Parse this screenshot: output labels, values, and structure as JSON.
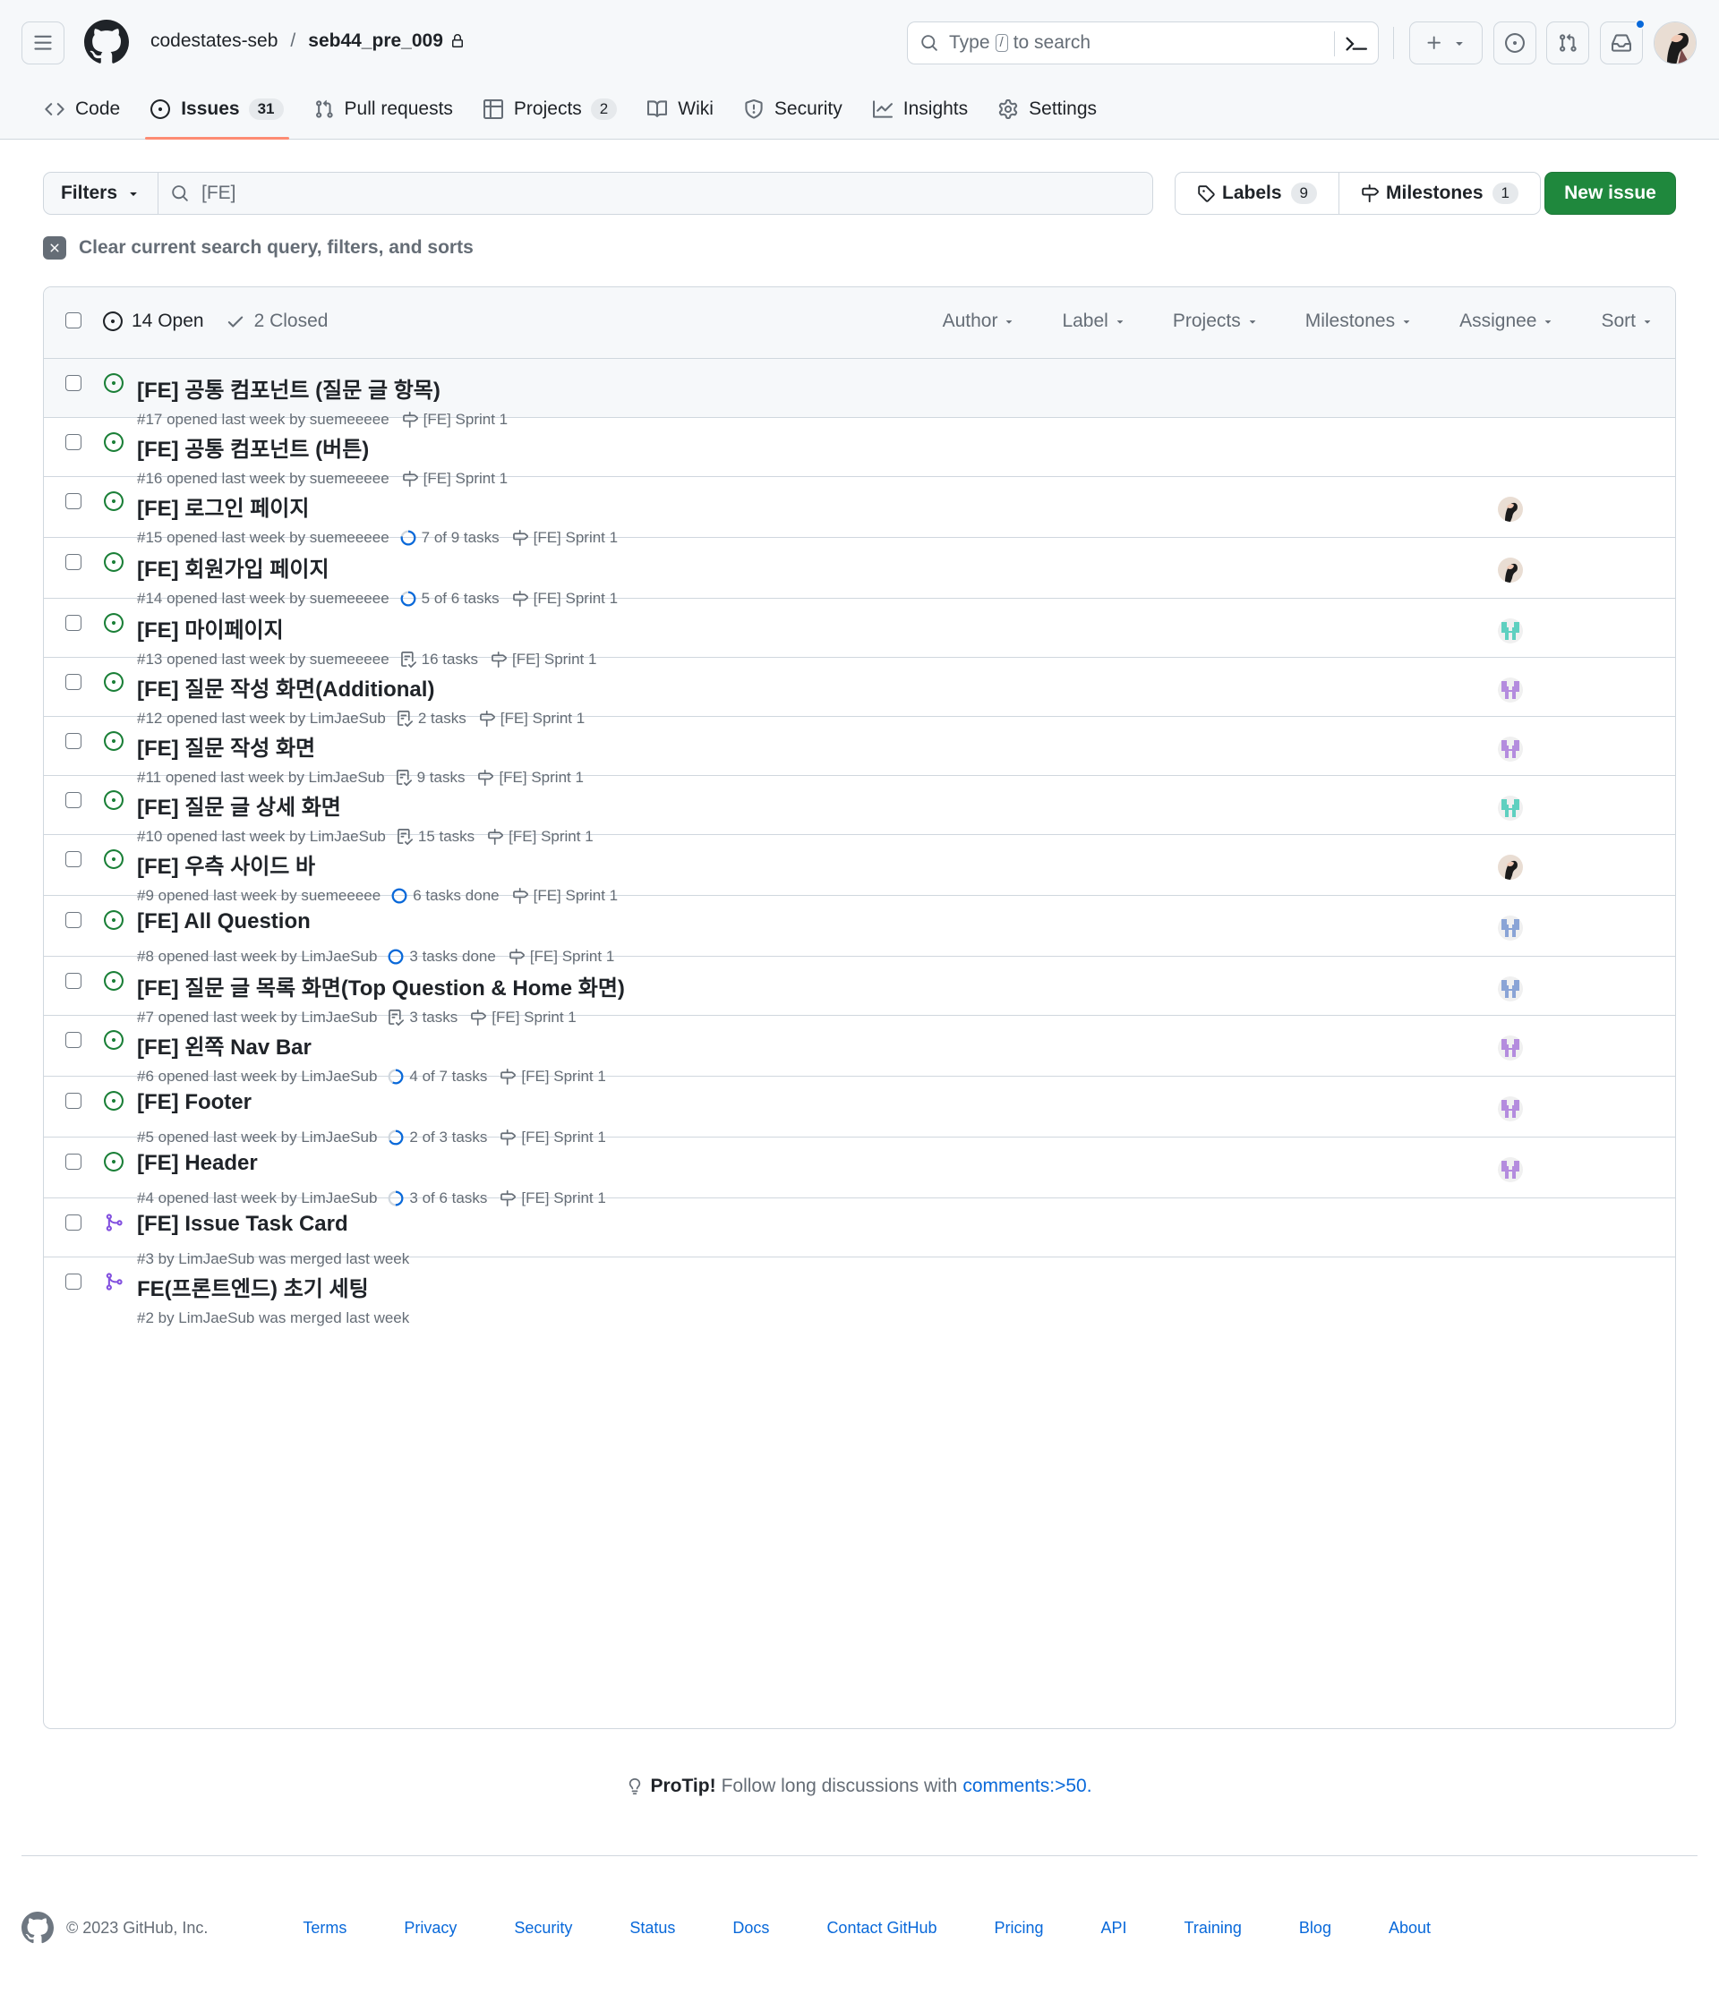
{
  "header": {
    "owner": "codestates-seb",
    "separator": "/",
    "repo": "seb44_pre_009",
    "search_prefix": "Type",
    "search_key": "/",
    "search_suffix": "to search"
  },
  "tabs": [
    {
      "label": "Code",
      "icon": "code-icon"
    },
    {
      "label": "Issues",
      "count": "31",
      "icon": "issue-opened-icon"
    },
    {
      "label": "Pull requests",
      "icon": "git-pull-request-icon"
    },
    {
      "label": "Projects",
      "count": "2",
      "icon": "table-icon"
    },
    {
      "label": "Wiki",
      "icon": "book-icon"
    },
    {
      "label": "Security",
      "icon": "shield-icon"
    },
    {
      "label": "Insights",
      "icon": "graph-icon"
    },
    {
      "label": "Settings",
      "icon": "gear-icon"
    }
  ],
  "filterbar": {
    "filters_label": "Filters",
    "query": "[FE]",
    "labels_label": "Labels",
    "labels_count": "9",
    "milestones_label": "Milestones",
    "milestones_count": "1",
    "new_issue_label": "New issue",
    "clear_label": "Clear current search query, filters, and sorts"
  },
  "list_header": {
    "open_label": "14 Open",
    "closed_label": "2 Closed",
    "filters": [
      "Author",
      "Label",
      "Projects",
      "Milestones",
      "Assignee",
      "Sort"
    ]
  },
  "issues": [
    {
      "title": "[FE] 공통 컴포넌트 (질문 글 항목)",
      "meta": "#17 opened last week by suemeeeee",
      "task": "",
      "task_icon": "",
      "milestone": "[FE] Sprint 1",
      "state": "open",
      "assignee": "",
      "highlighted": true
    },
    {
      "title": "[FE] 공통 컴포넌트 (버튼)",
      "meta": "#16 opened last week by suemeeeee",
      "task": "",
      "task_icon": "",
      "milestone": "[FE] Sprint 1",
      "state": "open",
      "assignee": ""
    },
    {
      "title": "[FE] 로그인 페이지",
      "meta": "#15 opened last week by suemeeeee",
      "task": "7 of 9 tasks",
      "task_icon": "progress",
      "task_progress": 0.78,
      "milestone": "[FE] Sprint 1",
      "state": "open",
      "assignee": "photo"
    },
    {
      "title": "[FE] 회원가입 페이지",
      "meta": "#14 opened last week by suemeeeee",
      "task": "5 of 6 tasks",
      "task_icon": "progress",
      "task_progress": 0.83,
      "milestone": "[FE] Sprint 1",
      "state": "open",
      "assignee": "photo"
    },
    {
      "title": "[FE] 마이페이지",
      "meta": "#13 opened last week by suemeeeee",
      "task": "16 tasks",
      "task_icon": "checklist",
      "milestone": "[FE] Sprint 1",
      "state": "open",
      "assignee": "teal"
    },
    {
      "title": "[FE] 질문 작성 화면(Additional)",
      "meta": "#12 opened last week by LimJaeSub",
      "task": "2 tasks",
      "task_icon": "checklist",
      "milestone": "[FE] Sprint 1",
      "state": "open",
      "assignee": "purple"
    },
    {
      "title": "[FE] 질문 작성 화면",
      "meta": "#11 opened last week by LimJaeSub",
      "task": "9 tasks",
      "task_icon": "checklist",
      "milestone": "[FE] Sprint 1",
      "state": "open",
      "assignee": "purple"
    },
    {
      "title": "[FE] 질문 글 상세 화면",
      "meta": "#10 opened last week by LimJaeSub",
      "task": "15 tasks",
      "task_icon": "checklist",
      "milestone": "[FE] Sprint 1",
      "state": "open",
      "assignee": "teal"
    },
    {
      "title": "[FE] 우측 사이드 바",
      "meta": "#9 opened last week by suemeeeee",
      "task": "6 tasks done",
      "task_icon": "done",
      "task_progress": 1,
      "milestone": "[FE] Sprint 1",
      "state": "open",
      "assignee": "photo"
    },
    {
      "title": "[FE] All Question",
      "meta": "#8 opened last week by LimJaeSub",
      "task": "3 tasks done",
      "task_icon": "done",
      "task_progress": 1,
      "milestone": "[FE] Sprint 1",
      "state": "open",
      "assignee": "blue"
    },
    {
      "title": "[FE] 질문 글 목록 화면(Top Question & Home 화면)",
      "meta": "#7 opened last week by LimJaeSub",
      "task": "3 tasks",
      "task_icon": "checklist",
      "milestone": "[FE] Sprint 1",
      "state": "open",
      "assignee": "blue"
    },
    {
      "title": "[FE] 왼쪽 Nav Bar",
      "meta": "#6 opened last week by LimJaeSub",
      "task": "4 of 7 tasks",
      "task_icon": "progress",
      "task_progress": 0.57,
      "milestone": "[FE] Sprint 1",
      "state": "open",
      "assignee": "purple"
    },
    {
      "title": "[FE] Footer",
      "meta": "#5 opened last week by LimJaeSub",
      "task": "2 of 3 tasks",
      "task_icon": "progress",
      "task_progress": 0.67,
      "milestone": "[FE] Sprint 1",
      "state": "open",
      "assignee": "purple"
    },
    {
      "title": "[FE] Header",
      "meta": "#4 opened last week by LimJaeSub",
      "task": "3 of 6 tasks",
      "task_icon": "progress",
      "task_progress": 0.5,
      "milestone": "[FE] Sprint 1",
      "state": "open",
      "assignee": "purple"
    },
    {
      "title": "[FE] Issue Task Card",
      "meta": "#3 by LimJaeSub was merged last week",
      "task": "",
      "task_icon": "",
      "milestone": "",
      "state": "merged",
      "assignee": ""
    },
    {
      "title": "FE(프론트엔드) 초기 세팅",
      "meta": "#2 by LimJaeSub was merged last week",
      "task": "",
      "task_icon": "",
      "milestone": "",
      "state": "merged",
      "assignee": ""
    }
  ],
  "protip": {
    "strong": "ProTip!",
    "text": "Follow long discussions with",
    "link": "comments:>50."
  },
  "footer": {
    "copyright": "© 2023 GitHub, Inc.",
    "links": [
      "Terms",
      "Privacy",
      "Security",
      "Status",
      "Docs",
      "Contact GitHub",
      "Pricing",
      "API",
      "Training",
      "Blog",
      "About"
    ]
  },
  "colors": {
    "open": "#1a7f37",
    "merged": "#8250df",
    "accent": "#0969da",
    "primary_button": "#1f883d",
    "tab_underline": "#fd8c73"
  }
}
